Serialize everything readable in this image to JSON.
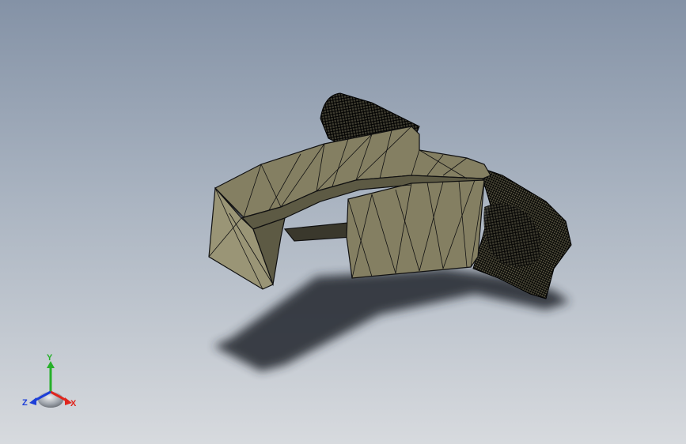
{
  "viewport": {
    "background_top": "#8492a6",
    "background_bottom": "#d7dade"
  },
  "model": {
    "face_color": "#847f62",
    "face_light": "#9a9576",
    "face_dark": "#5d5a44",
    "edge_color": "#111111",
    "shadow_color": "#262a30"
  },
  "triad": {
    "x_label": "X",
    "y_label": "Y",
    "z_label": "Z",
    "x_color": "#e0261e",
    "y_color": "#27b02a",
    "z_color": "#1d3fd8"
  }
}
